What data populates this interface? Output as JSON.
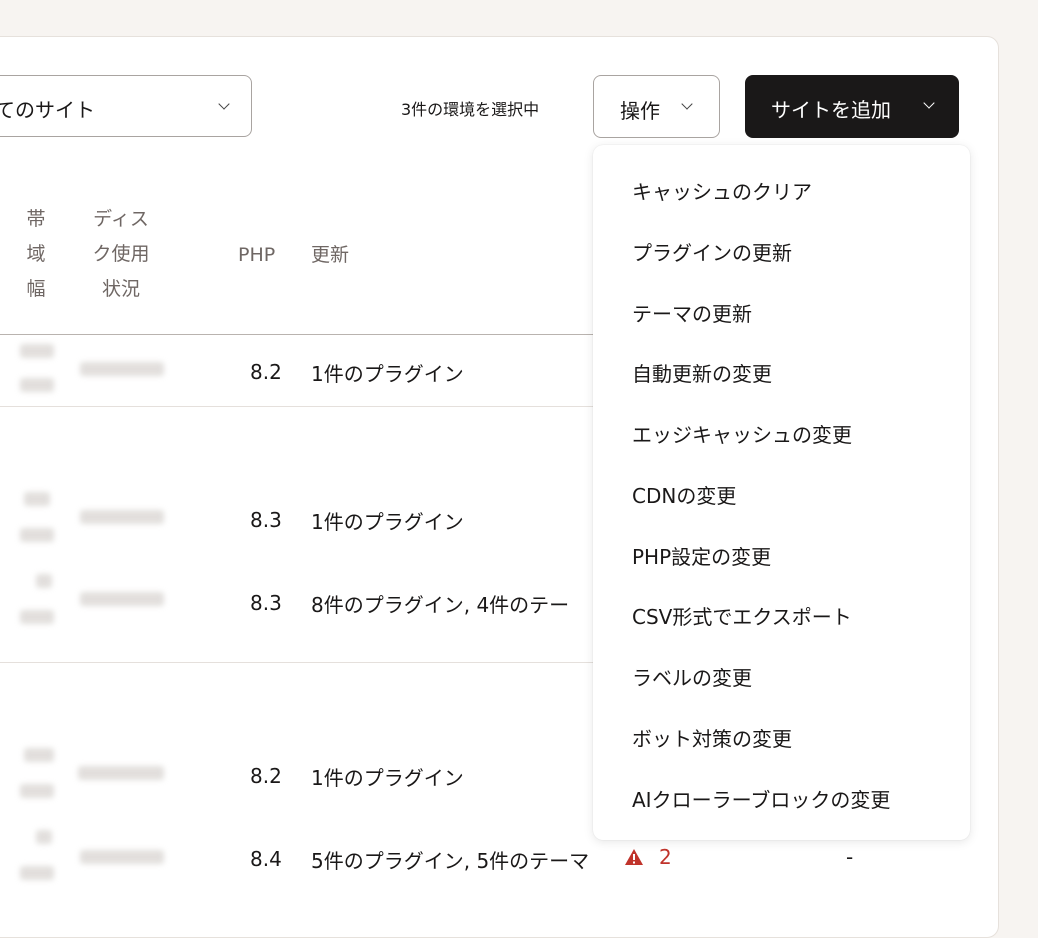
{
  "toolbar": {
    "site_filter_value": "てのサイト",
    "selected_count_text": "3件の環境を選択中",
    "operations_label": "操作",
    "add_site_label": "サイトを追加"
  },
  "table": {
    "headers": {
      "bandwidth": [
        "帯",
        "域",
        "幅"
      ],
      "disk_usage": [
        "ディス",
        "ク使用",
        "状況"
      ],
      "php": "PHP",
      "updates": "更新"
    },
    "rows": [
      {
        "php": "8.2",
        "updates": "1件のプラグイン"
      },
      {
        "php": "8.3",
        "updates": "1件のプラグイン"
      },
      {
        "php": "8.3",
        "updates": "8件のプラグイン, 4件のテー"
      },
      {
        "php": "8.2",
        "updates": "1件のプラグイン"
      },
      {
        "php": "8.4",
        "updates": "5件のプラグイン, 5件のテーマ",
        "warning_count": "2",
        "extra": "-"
      }
    ]
  },
  "operations_menu": {
    "items": [
      "キャッシュのクリア",
      "プラグインの更新",
      "テーマの更新",
      "自動更新の変更",
      "エッジキャッシュの変更",
      "CDNの変更",
      "PHP設定の変更",
      "CSV形式でエクスポート",
      "ラベルの変更",
      "ボット対策の変更",
      "AIクローラーブロックの変更"
    ]
  },
  "colors": {
    "page_bg": "#f7f4f1",
    "primary_button": "#1a1818",
    "warning": "#c0332b",
    "header_text": "#6f6764"
  }
}
